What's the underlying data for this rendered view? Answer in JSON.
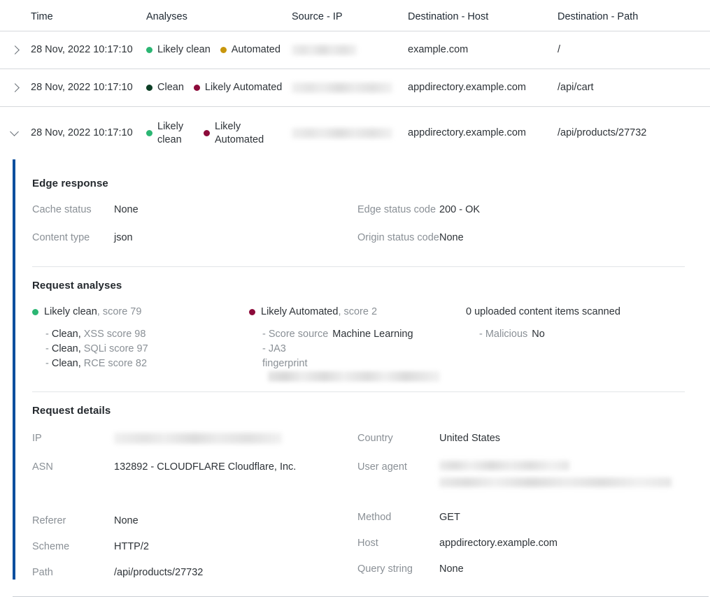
{
  "table": {
    "columns": [
      "Time",
      "Analyses",
      "Source - IP",
      "Destination - Host",
      "Destination - Path"
    ],
    "rows": [
      {
        "expanded": false,
        "chevron_icon": "chevron-right-icon",
        "time": "28 Nov, 2022 10:17:10",
        "analyses": [
          {
            "label": "Likely clean",
            "color": "#2bb673"
          },
          {
            "label": "Automated",
            "color": "#c8960c"
          }
        ],
        "source_ip_redacted": true,
        "destination_host": "example.com",
        "destination_path": "/"
      },
      {
        "expanded": false,
        "chevron_icon": "chevron-right-icon",
        "time": "28 Nov, 2022 10:17:10",
        "analyses": [
          {
            "label": "Clean",
            "color": "#0d3f26"
          },
          {
            "label": "Likely Automated",
            "color": "#8c0b3a"
          }
        ],
        "source_ip_redacted": true,
        "destination_host": "appdirectory.example.com",
        "destination_path": "/api/cart"
      },
      {
        "expanded": true,
        "chevron_icon": "chevron-down-icon",
        "time": "28 Nov, 2022 10:17:10",
        "analyses": [
          {
            "label": "Likely clean",
            "color": "#2bb673"
          },
          {
            "label": "Likely Automated",
            "color": "#8c0b3a"
          }
        ],
        "source_ip_redacted": true,
        "destination_host": "appdirectory.example.com",
        "destination_path": "/api/products/27732"
      }
    ]
  },
  "detail": {
    "accent_color": "#0b4f9e",
    "edge_response": {
      "title": "Edge response",
      "left": [
        {
          "key": "Cache status",
          "value": "None"
        },
        {
          "key": "Content type",
          "value": "json"
        }
      ],
      "right": [
        {
          "key": "Edge status code",
          "value": "200 - OK"
        },
        {
          "key": "Origin status code",
          "value": "None"
        }
      ]
    },
    "request_analyses": {
      "title": "Request analyses",
      "columns": [
        {
          "heading": "Likely clean",
          "heading_suffix": ", score 79",
          "dot_color": "#2bb673",
          "items": [
            {
              "strong": "Clean,",
              "muted": "XSS score 98"
            },
            {
              "strong": "Clean,",
              "muted": "SQLi score 97"
            },
            {
              "strong": "Clean,",
              "muted": "RCE score 82"
            }
          ]
        },
        {
          "heading": "Likely Automated",
          "heading_suffix": ", score 2",
          "dot_color": "#8c0b3a",
          "items": [
            {
              "muted": "Score source",
              "value": "Machine Learning"
            },
            {
              "muted": "JA3",
              "muted_cont": "fingerprint",
              "redacted": true
            }
          ]
        },
        {
          "heading": "0 uploaded content items scanned",
          "heading_suffix": "",
          "dot_color": null,
          "items": [
            {
              "muted": "Malicious",
              "value": "No"
            }
          ]
        }
      ]
    },
    "request_details": {
      "title": "Request details",
      "left": [
        {
          "key": "IP",
          "value": "",
          "redacted": true
        },
        {
          "key": "ASN",
          "value": "132892 - CLOUDFLARE Cloudflare, Inc."
        },
        {
          "key": "Referer",
          "value": "None"
        },
        {
          "key": "Scheme",
          "value": "HTTP/2"
        },
        {
          "key": "Path",
          "value": "/api/products/27732"
        }
      ],
      "right": [
        {
          "key": "Country",
          "value": "United States"
        },
        {
          "key": "User agent",
          "value": "",
          "redacted": true
        },
        {
          "key": "Method",
          "value": "GET"
        },
        {
          "key": "Host",
          "value": "appdirectory.example.com"
        },
        {
          "key": "Query string",
          "value": "None"
        }
      ]
    }
  }
}
